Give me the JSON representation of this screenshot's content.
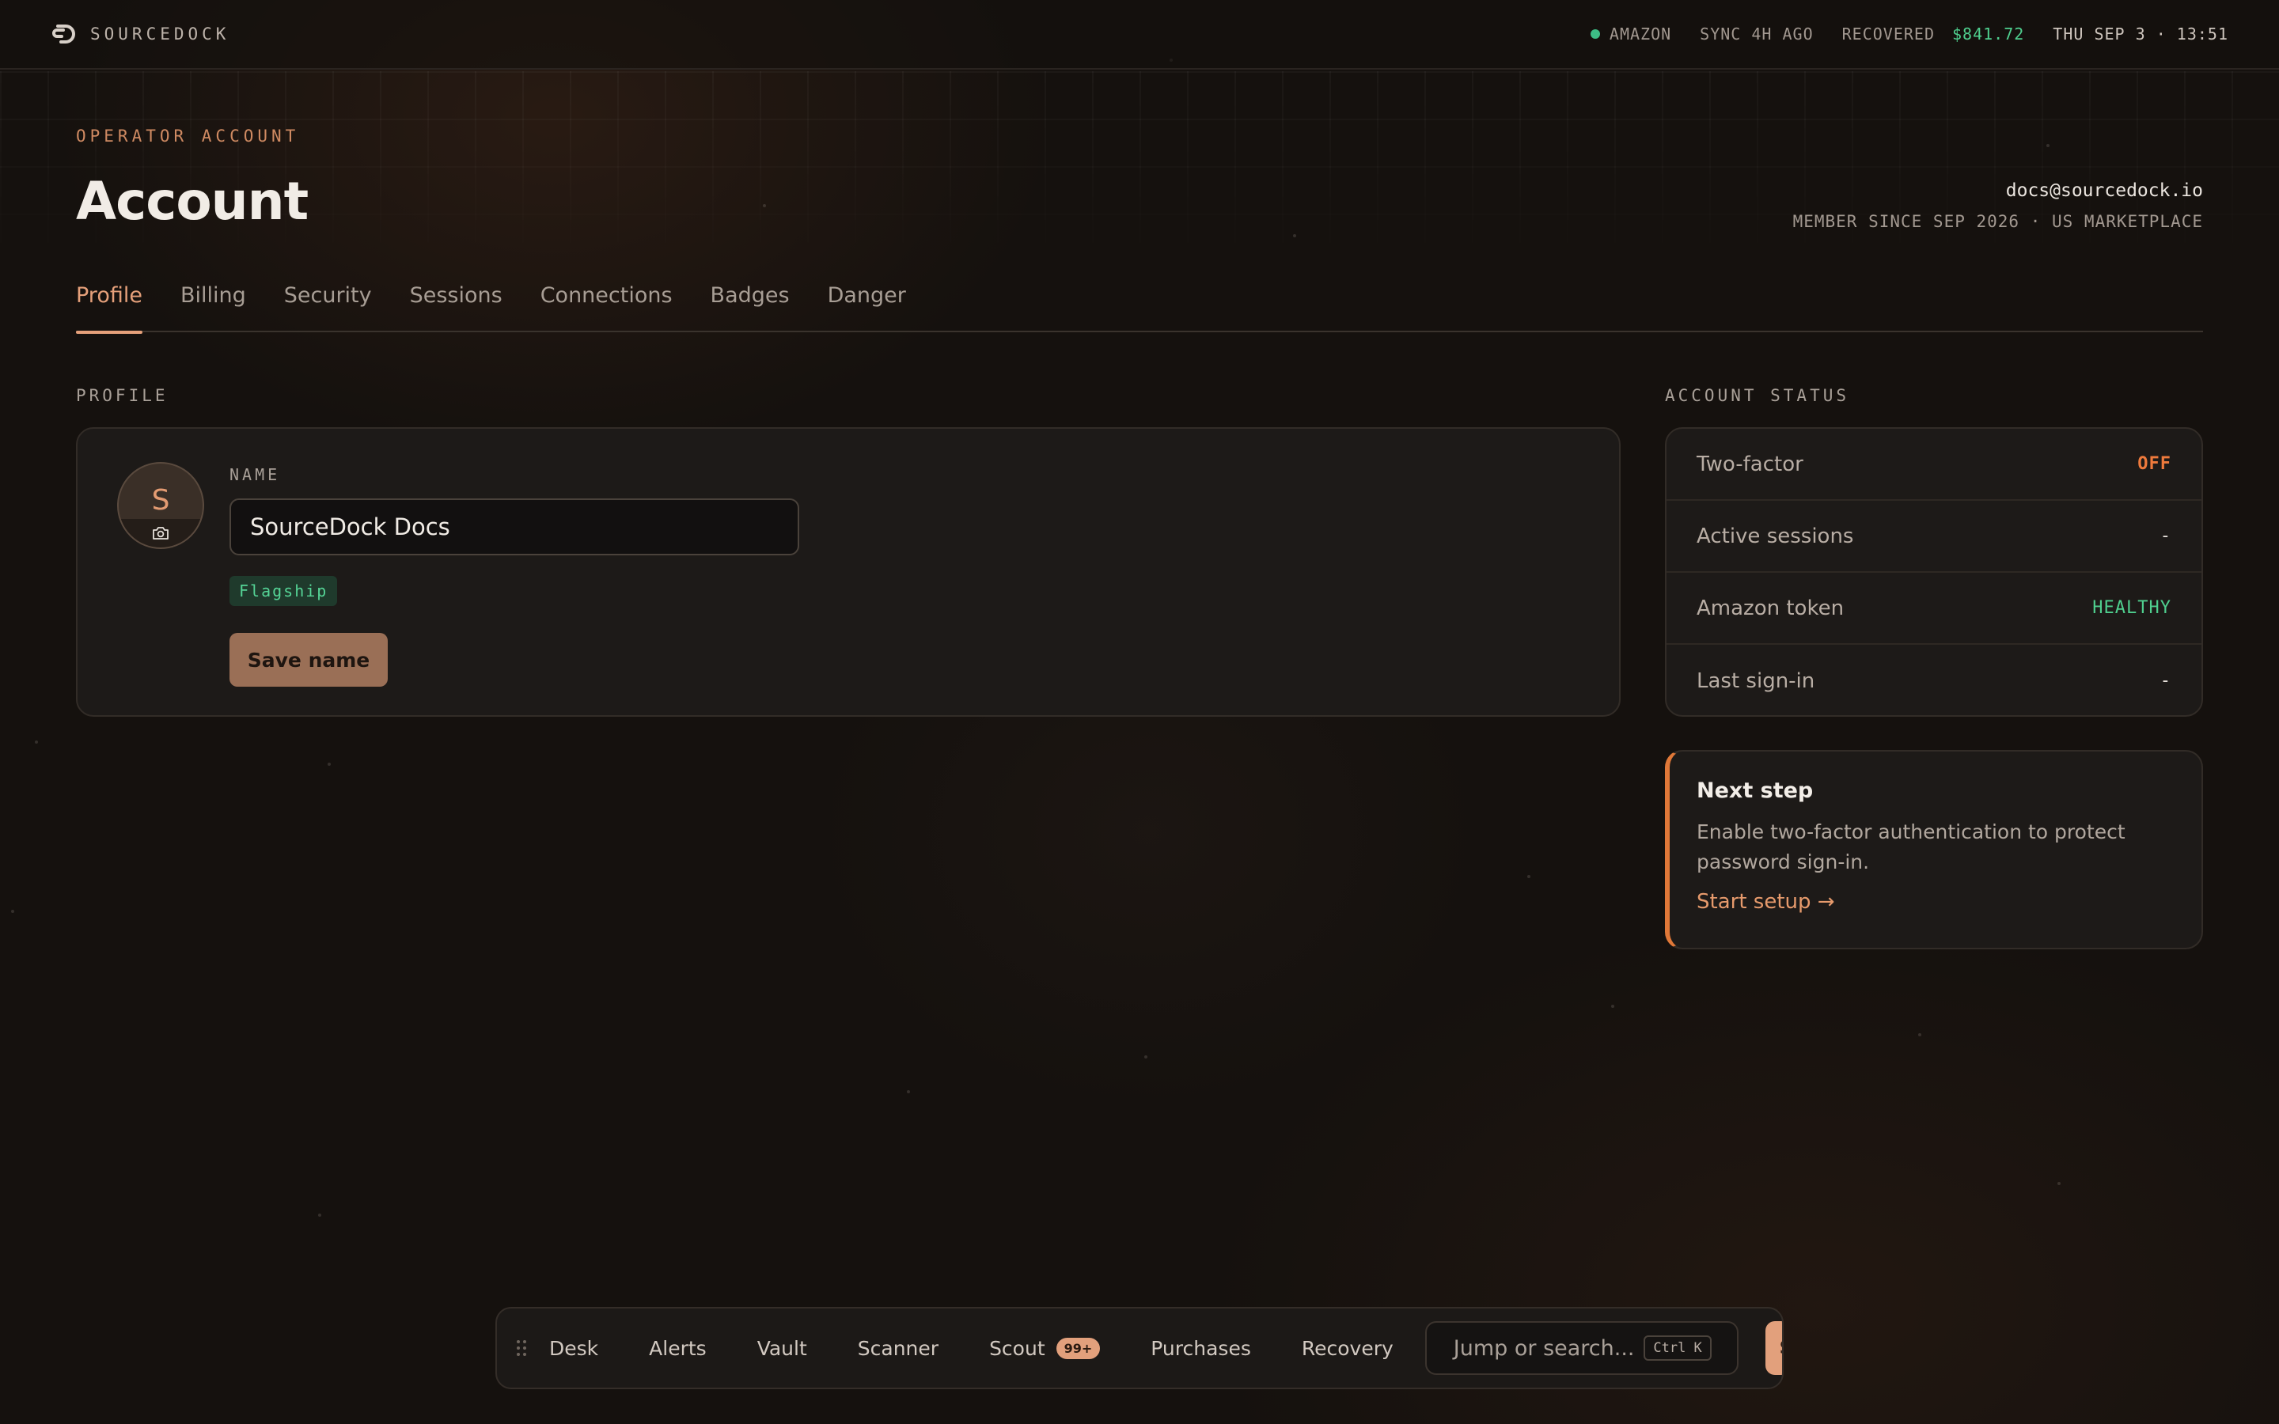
{
  "topbar": {
    "brand_name": "SOURCEDOCK",
    "marketplace": "AMAZON",
    "sync": "SYNC 4H AGO",
    "recovered_label": "RECOVERED",
    "recovered_amount": "$841.72",
    "datetime": "THU SEP 3 · 13:51"
  },
  "header": {
    "eyebrow": "OPERATOR ACCOUNT",
    "title": "Account",
    "email": "docs@sourcedock.io",
    "member_since": "MEMBER SINCE SEP 2026 · US MARKETPLACE"
  },
  "tabs": [
    {
      "label": "Profile",
      "active": true
    },
    {
      "label": "Billing"
    },
    {
      "label": "Security"
    },
    {
      "label": "Sessions"
    },
    {
      "label": "Connections"
    },
    {
      "label": "Badges"
    },
    {
      "label": "Danger"
    }
  ],
  "profile": {
    "section_label": "PROFILE",
    "avatar_letter": "S",
    "name_label": "NAME",
    "name_value": "SourceDock Docs",
    "badge": "Flagship",
    "save_label": "Save name"
  },
  "account_status": {
    "section_label": "ACCOUNT STATUS",
    "rows": [
      {
        "key": "Two-factor",
        "value": "OFF"
      },
      {
        "key": "Active sessions",
        "value": "-"
      },
      {
        "key": "Amazon token",
        "value": "HEALTHY"
      },
      {
        "key": "Last sign-in",
        "value": "-"
      }
    ]
  },
  "next_step": {
    "title": "Next step",
    "body": "Enable two-factor authentication to protect password sign-in.",
    "link": "Start setup →"
  },
  "dock": {
    "items": [
      "Desk",
      "Alerts",
      "Vault",
      "Scanner",
      "Scout",
      "Purchases",
      "Recovery"
    ],
    "scout_badge": "99+",
    "search_placeholder": "Jump or search...",
    "shortcut": "Ctrl K",
    "avatar_initials": "SD"
  },
  "colors": {
    "accent": "#e5a07a",
    "warning": "#ee7a3c",
    "success": "#4fcf8e",
    "background": "#15110e"
  },
  "icons": {
    "brand": "sourcedock-logo-icon",
    "avatar_upload": "camera-icon",
    "dock_handle": "drag-handle-icon"
  }
}
